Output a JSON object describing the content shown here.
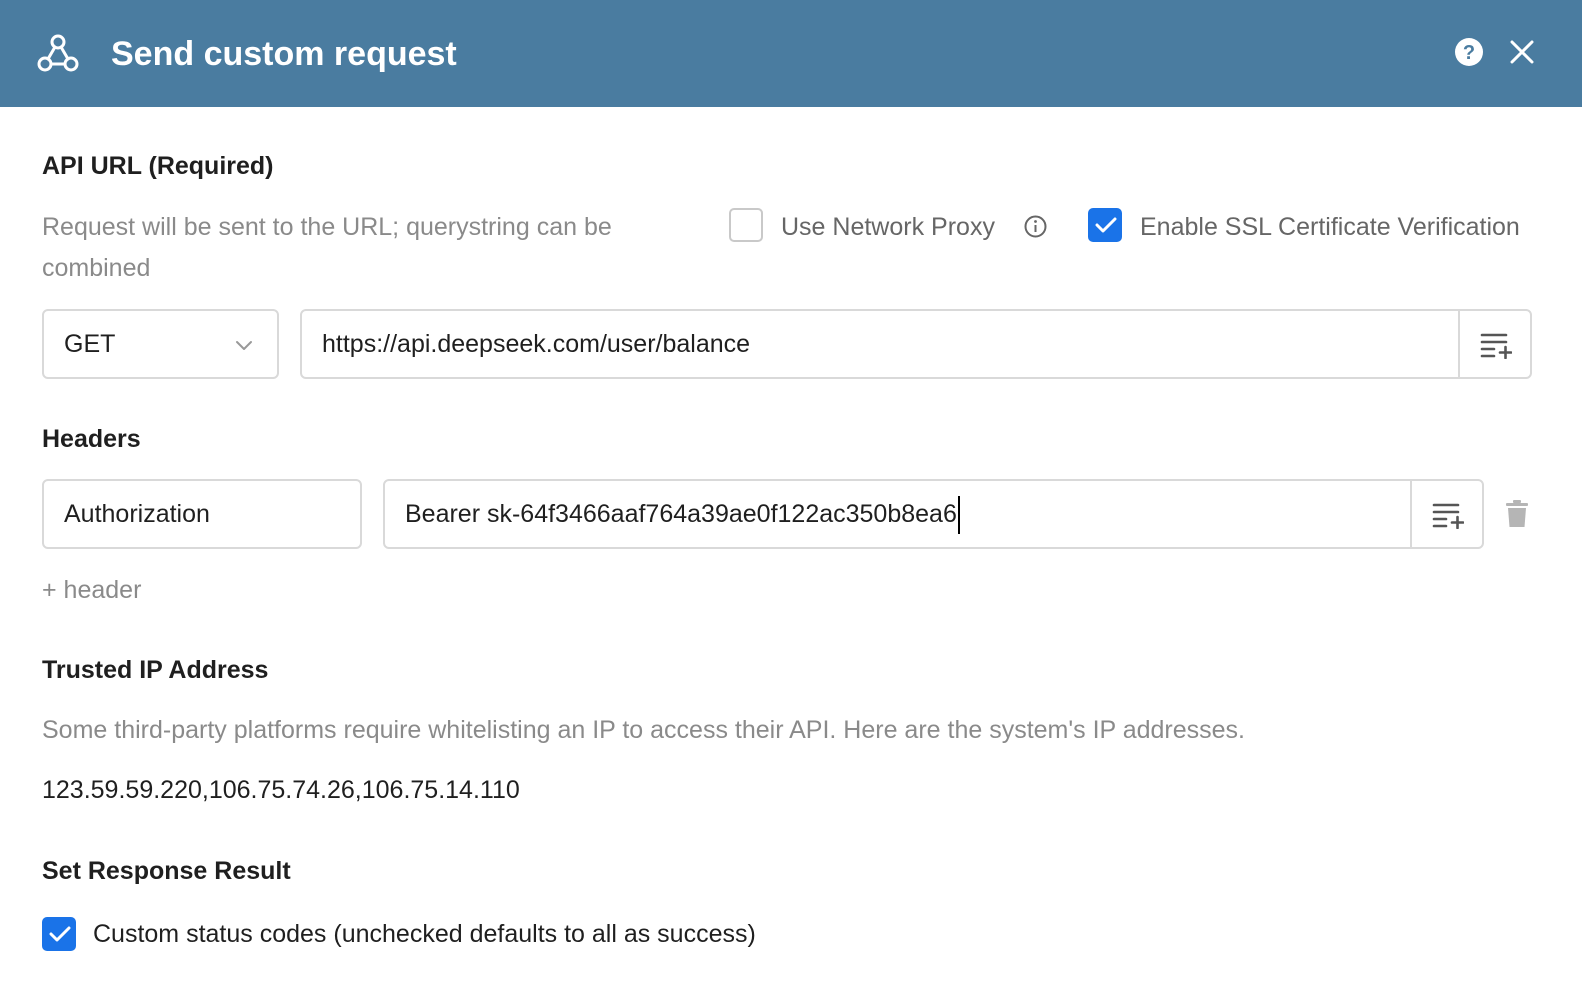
{
  "header": {
    "title": "Send custom request",
    "logo_icon": "webhook-icon",
    "help_icon": "help-icon",
    "close_icon": "close-icon",
    "bg_color": "#4a7ca0"
  },
  "api_url": {
    "label": "API URL (Required)",
    "description": "Request will be sent to the URL; querystring can be combined",
    "use_network_proxy": {
      "label": "Use Network Proxy",
      "checked": false
    },
    "enable_ssl": {
      "label": "Enable SSL Certificate Verification",
      "checked": true
    },
    "method": "GET",
    "url": "https://api.deepseek.com/user/balance"
  },
  "headers": {
    "label": "Headers",
    "items": [
      {
        "key": "Authorization",
        "value": "Bearer sk-64f3466aaf764a39ae0f122ac350b8ea6"
      }
    ],
    "add_label": "+ header"
  },
  "trusted_ip": {
    "label": "Trusted IP Address",
    "description": "Some third-party platforms require whitelisting an IP to access their API. Here are the system's IP addresses.",
    "ips": "123.59.59.220,106.75.74.26,106.75.14.110"
  },
  "response": {
    "label": "Set Response Result",
    "custom_status": {
      "label": "Custom status codes (unchecked defaults to all as success)",
      "checked": true
    }
  },
  "accent_color": "#1a73e8"
}
